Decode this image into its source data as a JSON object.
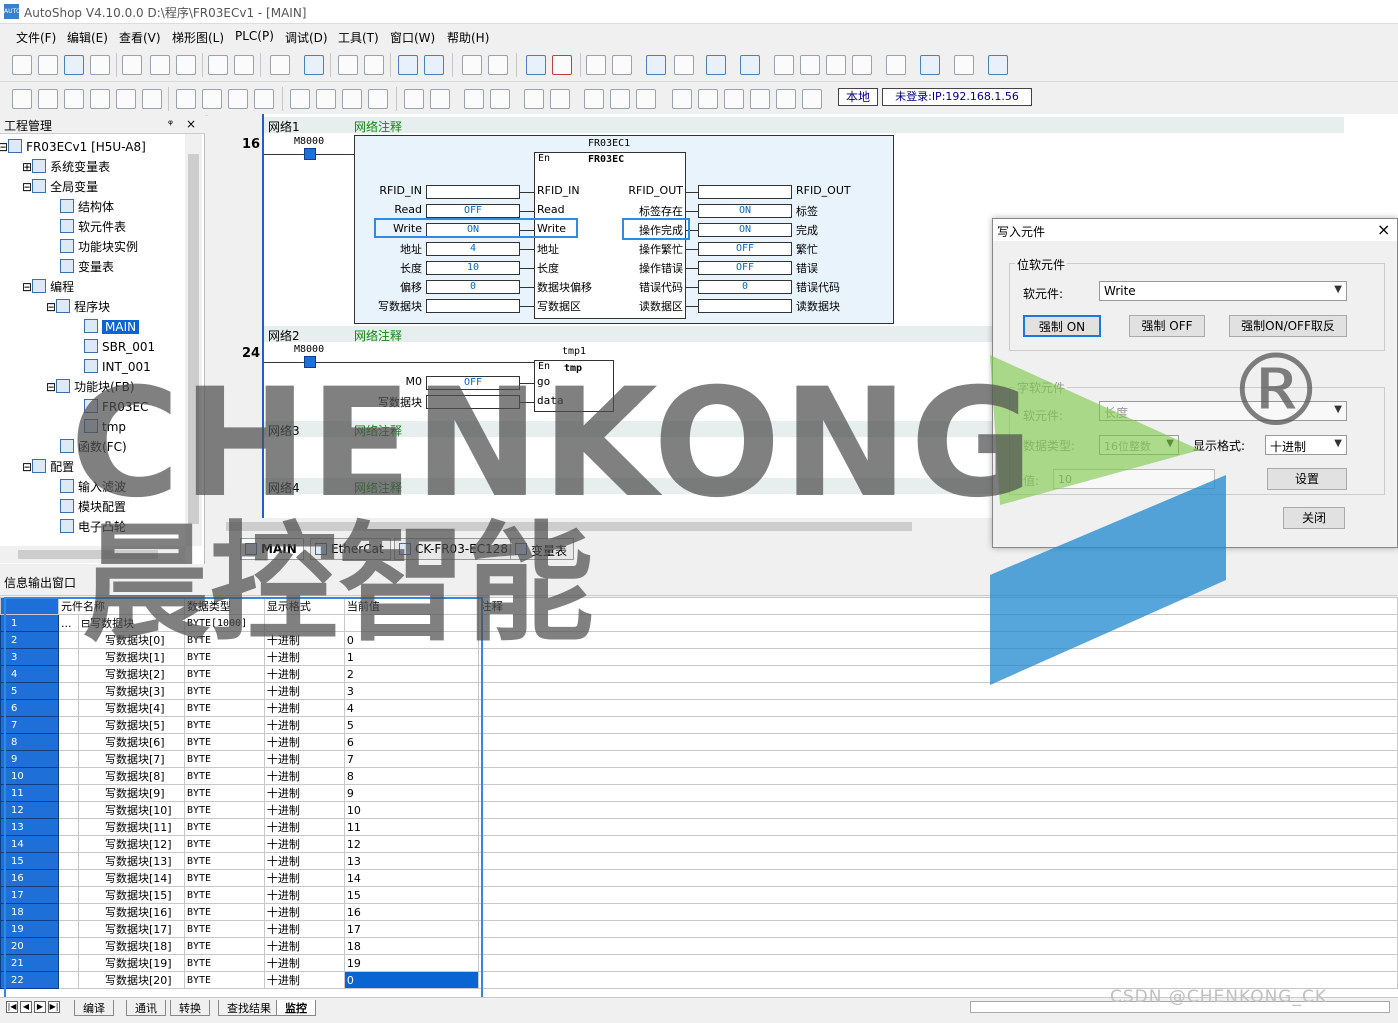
{
  "window": {
    "title": "AutoShop V4.10.0.0   D:\\程序\\FR03ECv1 - [MAIN]",
    "logo": "AUTO"
  },
  "menu": [
    "文件(F)",
    "编辑(E)",
    "查看(V)",
    "梯形图(L)",
    "PLC(P)",
    "调试(D)",
    "工具(T)",
    "窗口(W)",
    "帮助(H)"
  ],
  "toolbar": {
    "local_label": "本地",
    "login_label": "未登录:IP:192.168.1.56"
  },
  "project": {
    "header": "工程管理",
    "pin": "ᵠ",
    "close": "×",
    "items": [
      {
        "label": "FR03ECv1 [H5U-A8]",
        "level": 0,
        "icon": "plc-icon",
        "expander": "⊟"
      },
      {
        "label": "系统变量表",
        "level": 1,
        "icon": "globe-icon",
        "expander": "⊞"
      },
      {
        "label": "全局变量",
        "level": 1,
        "icon": "table-icon",
        "expander": "⊟"
      },
      {
        "label": "结构体",
        "level": 2,
        "icon": "struct-icon"
      },
      {
        "label": "软元件表",
        "level": 2,
        "icon": "list-icon"
      },
      {
        "label": "功能块实例",
        "level": 2,
        "icon": "cube-icon"
      },
      {
        "label": "变量表",
        "level": 2,
        "icon": "globe-icon"
      },
      {
        "label": "编程",
        "level": 1,
        "icon": "ladder-icon",
        "expander": "⊟"
      },
      {
        "label": "程序块",
        "level": 2,
        "icon": "blocks-icon",
        "expander": "⊟"
      },
      {
        "label": "MAIN",
        "level": 3,
        "icon": "program-icon",
        "selected": true
      },
      {
        "label": "SBR_001",
        "level": 3,
        "icon": "program-icon"
      },
      {
        "label": "INT_001",
        "level": 3,
        "icon": "program-icon"
      },
      {
        "label": "功能块(FB)",
        "level": 2,
        "icon": "fb-folder-icon",
        "expander": "⊟"
      },
      {
        "label": "FR03EC",
        "level": 3,
        "icon": "fb-icon"
      },
      {
        "label": "tmp",
        "level": 3,
        "icon": "fb-icon"
      },
      {
        "label": "函数(FC)",
        "level": 2,
        "icon": "fc-icon"
      },
      {
        "label": "配置",
        "level": 1,
        "icon": "config-icon",
        "expander": "⊟"
      },
      {
        "label": "输入滤波",
        "level": 2,
        "icon": "filter-icon"
      },
      {
        "label": "模块配置",
        "level": 2,
        "icon": "check-icon"
      },
      {
        "label": "电子凸轮",
        "level": 2,
        "icon": "cam-icon"
      }
    ]
  },
  "editor": {
    "networks": [
      {
        "name": "网络1",
        "comment": "网络注释"
      },
      {
        "name": "网络2",
        "comment": "网络注释"
      },
      {
        "name": "网络3",
        "comment": "网络注释"
      },
      {
        "name": "网络4",
        "comment": "网络注释"
      }
    ],
    "rung1": {
      "number": "16",
      "contact": "M8000",
      "instance": "FR03EC1",
      "type": "FR03EC",
      "en": "En",
      "inputs": [
        {
          "outer": "RFID_IN",
          "value": "",
          "pin": "RFID_IN"
        },
        {
          "outer": "Read",
          "value": "OFF",
          "pin": "Read"
        },
        {
          "outer": "Write",
          "value": "ON",
          "pin": "Write"
        },
        {
          "outer": "地址",
          "value": "4",
          "pin": "地址"
        },
        {
          "outer": "长度",
          "value": "10",
          "pin": "长度"
        },
        {
          "outer": "偏移",
          "value": "0",
          "pin": "数据块偏移"
        },
        {
          "outer": "写数据块",
          "value": "",
          "pin": "写数据区"
        }
      ],
      "outputs": [
        {
          "pin": "RFID_OUT",
          "value": "",
          "outer": "RFID_OUT"
        },
        {
          "pin": "标签存在",
          "value": "ON",
          "outer": "标签"
        },
        {
          "pin": "操作完成",
          "value": "ON",
          "outer": "完成"
        },
        {
          "pin": "操作繁忙",
          "value": "OFF",
          "outer": "繁忙"
        },
        {
          "pin": "操作错误",
          "value": "OFF",
          "outer": "错误"
        },
        {
          "pin": "错误代码",
          "value": "0",
          "outer": "错误代码"
        },
        {
          "pin": "读数据区",
          "value": "",
          "outer": "读数据块"
        }
      ]
    },
    "rung2": {
      "number": "24",
      "contact": "M8000",
      "instance": "tmp1",
      "type": "tmp",
      "en": "En",
      "inputs": [
        {
          "outer": "M0",
          "value": "OFF",
          "pin": "go"
        },
        {
          "outer": "写数据块",
          "value": "",
          "pin": "data"
        }
      ]
    },
    "tabs": [
      "MAIN",
      "EtherCat",
      "CK-FR03-EC128",
      "变量表"
    ]
  },
  "dialog": {
    "title": "写入元件",
    "close": "×",
    "bit_group": "位软元件",
    "bit_label": "软元件:",
    "bit_value": "Write",
    "force_on": "强制 ON",
    "force_off": "强制 OFF",
    "force_toggle": "强制ON/OFF取反",
    "word_group": "字软元件",
    "word_label": "软元件:",
    "word_value": "长度",
    "dtype_label": "数据类型:",
    "dtype_value": "16位整数",
    "fmt_label": "显示格式:",
    "fmt_value": "十进制",
    "val_label": "值:",
    "val_value": "10",
    "set_btn": "设置",
    "close_btn": "关闭"
  },
  "info": {
    "header": "信息输出窗口",
    "columns": [
      "元件名称",
      "数据类型",
      "显示格式",
      "当前值",
      "注释"
    ],
    "parent": {
      "row": "1",
      "name": "写数据块",
      "type": "BYTE[1000]",
      "expander": "⊟",
      "dots": "..."
    },
    "rows": [
      {
        "row": "2",
        "name": "写数据块[0]",
        "type": "BYTE",
        "fmt": "十进制",
        "val": "0"
      },
      {
        "row": "3",
        "name": "写数据块[1]",
        "type": "BYTE",
        "fmt": "十进制",
        "val": "1"
      },
      {
        "row": "4",
        "name": "写数据块[2]",
        "type": "BYTE",
        "fmt": "十进制",
        "val": "2"
      },
      {
        "row": "5",
        "name": "写数据块[3]",
        "type": "BYTE",
        "fmt": "十进制",
        "val": "3"
      },
      {
        "row": "6",
        "name": "写数据块[4]",
        "type": "BYTE",
        "fmt": "十进制",
        "val": "4"
      },
      {
        "row": "7",
        "name": "写数据块[5]",
        "type": "BYTE",
        "fmt": "十进制",
        "val": "5"
      },
      {
        "row": "8",
        "name": "写数据块[6]",
        "type": "BYTE",
        "fmt": "十进制",
        "val": "6"
      },
      {
        "row": "9",
        "name": "写数据块[7]",
        "type": "BYTE",
        "fmt": "十进制",
        "val": "7"
      },
      {
        "row": "10",
        "name": "写数据块[8]",
        "type": "BYTE",
        "fmt": "十进制",
        "val": "8"
      },
      {
        "row": "11",
        "name": "写数据块[9]",
        "type": "BYTE",
        "fmt": "十进制",
        "val": "9"
      },
      {
        "row": "12",
        "name": "写数据块[10]",
        "type": "BYTE",
        "fmt": "十进制",
        "val": "10"
      },
      {
        "row": "13",
        "name": "写数据块[11]",
        "type": "BYTE",
        "fmt": "十进制",
        "val": "11"
      },
      {
        "row": "14",
        "name": "写数据块[12]",
        "type": "BYTE",
        "fmt": "十进制",
        "val": "12"
      },
      {
        "row": "15",
        "name": "写数据块[13]",
        "type": "BYTE",
        "fmt": "十进制",
        "val": "13"
      },
      {
        "row": "16",
        "name": "写数据块[14]",
        "type": "BYTE",
        "fmt": "十进制",
        "val": "14"
      },
      {
        "row": "17",
        "name": "写数据块[15]",
        "type": "BYTE",
        "fmt": "十进制",
        "val": "15"
      },
      {
        "row": "18",
        "name": "写数据块[16]",
        "type": "BYTE",
        "fmt": "十进制",
        "val": "16"
      },
      {
        "row": "19",
        "name": "写数据块[17]",
        "type": "BYTE",
        "fmt": "十进制",
        "val": "17"
      },
      {
        "row": "20",
        "name": "写数据块[18]",
        "type": "BYTE",
        "fmt": "十进制",
        "val": "18"
      },
      {
        "row": "21",
        "name": "写数据块[19]",
        "type": "BYTE",
        "fmt": "十进制",
        "val": "19"
      },
      {
        "row": "22",
        "name": "写数据块[20]",
        "type": "BYTE",
        "fmt": "十进制",
        "val": "0",
        "selected": true
      }
    ],
    "bottom_tabs": [
      "编译",
      "通讯",
      "转换",
      "查找结果",
      "监控"
    ]
  },
  "watermark": {
    "brand_en": "CHENKONG",
    "brand_cn": "晨控智能",
    "reg": "®",
    "csdn": "CSDN @CHENKONG_CK"
  },
  "colors": {
    "selection": "#0a64d2",
    "highlight": "#2f8be0",
    "contact": "#1e6fd8",
    "comment": "#118811"
  }
}
